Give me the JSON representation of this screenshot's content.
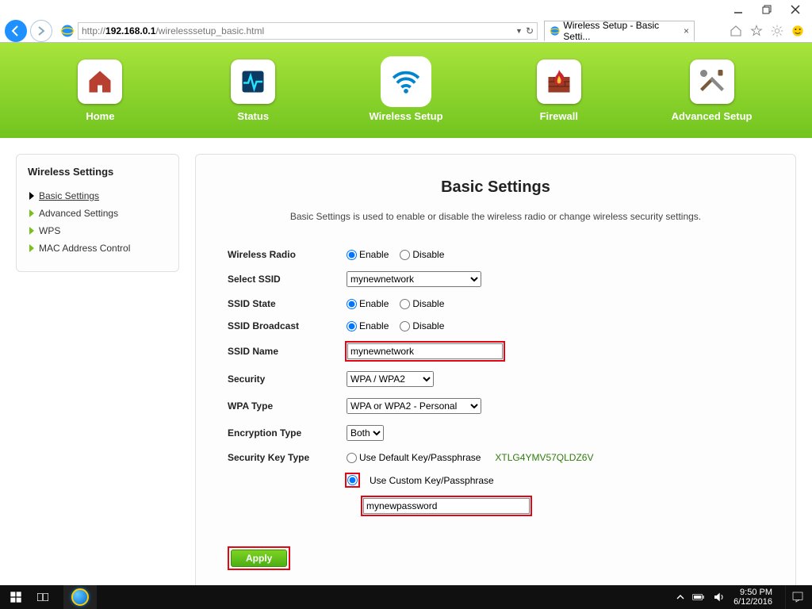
{
  "browser": {
    "url_host": "192.168.0.1",
    "url_pre": "http://",
    "url_path": "/wirelesssetup_basic.html",
    "tab_title": "Wireless Setup - Basic Setti..."
  },
  "nav": {
    "home": "Home",
    "status": "Status",
    "wireless": "Wireless Setup",
    "firewall": "Firewall",
    "advanced": "Advanced Setup"
  },
  "sidebar": {
    "title": "Wireless Settings",
    "items": [
      {
        "label": "Basic Settings",
        "active": true
      },
      {
        "label": "Advanced Settings"
      },
      {
        "label": "WPS"
      },
      {
        "label": "MAC Address Control"
      }
    ]
  },
  "page": {
    "title": "Basic Settings",
    "desc": "Basic Settings is used to enable or disable the wireless radio or change wireless security settings."
  },
  "form": {
    "wireless_radio_label": "Wireless Radio",
    "enable": "Enable",
    "disable": "Disable",
    "select_ssid_label": "Select SSID",
    "select_ssid_value": "mynewnetwork",
    "ssid_state_label": "SSID State",
    "ssid_broadcast_label": "SSID Broadcast",
    "ssid_name_label": "SSID Name",
    "ssid_name_value": "mynewnetwork",
    "security_label": "Security",
    "security_value": "WPA / WPA2",
    "wpa_type_label": "WPA Type",
    "wpa_type_value": "WPA or WPA2 - Personal",
    "encryption_label": "Encryption Type",
    "encryption_value": "Both",
    "sectype_label": "Security Key Type",
    "default_key_label": "Use Default Key/Passphrase",
    "default_key": "XTLG4YMV57QLDZ6V",
    "custom_key_label": "Use Custom Key/Passphrase",
    "custom_key_value": "mynewpassword",
    "apply": "Apply"
  },
  "taskbar": {
    "time": "9:50 PM",
    "date": "6/12/2016"
  }
}
